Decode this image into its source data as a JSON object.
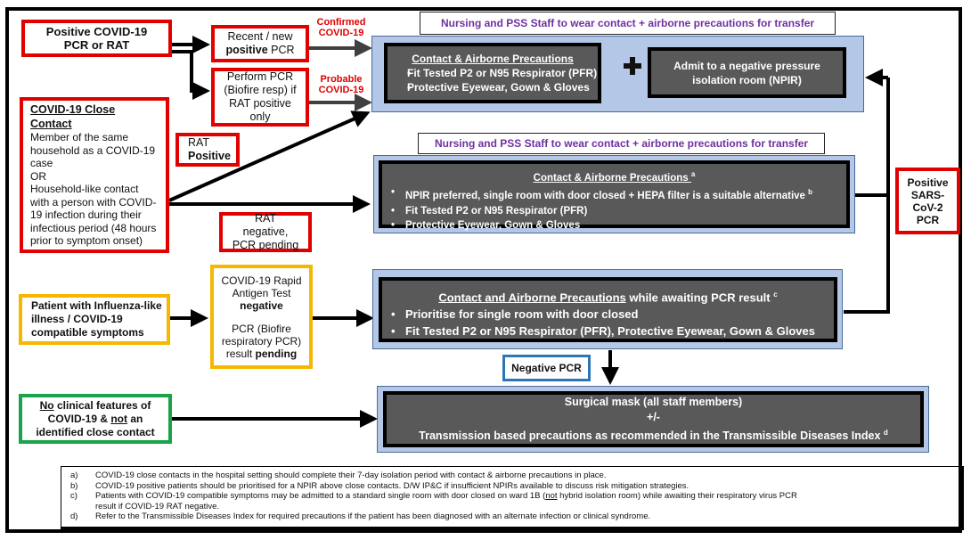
{
  "left_boxes": {
    "positive_covid": "Positive COVID-19 PCR or RAT",
    "close_contact": {
      "title": "COVID-19 Close Contact",
      "line1": "Member of the same household as a COVID-19 case",
      "or": "OR",
      "line2": "Household-like contact with a person with COVID-19 infection during their infectious period (48 hours prior to symptom onset)"
    },
    "influenza": "Patient with Influenza-like illness / COVID-19 compatible symptoms",
    "no_features": {
      "part1": "No",
      "part2": " clinical features of COVID-19 & ",
      "part3": "not",
      "part4": " an identified close contact"
    }
  },
  "middle_boxes": {
    "recent_pcr": {
      "line1": "Recent / new",
      "bold": "positive",
      "rest": " PCR"
    },
    "perform_pcr": "Perform PCR (Biofire resp) if RAT positive only",
    "rat_positive": {
      "line1": "RAT",
      "bold": "Positive"
    },
    "rat_negative": "RAT negative, PCR pending",
    "rapid_antigen": {
      "line1": "COVID-19 Rapid Antigen Test",
      "bold1": "negative",
      "line2": "PCR (Biofire respiratory PCR) result",
      "bold2": "pending"
    },
    "negative_pcr": "Negative PCR"
  },
  "labels": {
    "confirmed": "Confirmed COVID-19",
    "probable": "Probable COVID-19"
  },
  "transfer_notes": [
    "Nursing and PSS Staff to wear contact + airborne precautions for transfer",
    "Nursing and PSS Staff to wear contact + airborne precautions for transfer"
  ],
  "panel1": {
    "title": "Contact & Airborne Precautions",
    "items": [
      "Fit Tested P2 or N95 Respirator (PFR)",
      "Protective Eyewear, Gown & Gloves"
    ],
    "plus_icon": "plus-icon",
    "npir": "Admit to a negative pressure isolation room (NPIR)"
  },
  "panel2": {
    "title": "Contact & Airborne Precautions",
    "title_sup": "a",
    "items": [
      {
        "text": "NPIR preferred, single room with door closed + HEPA filter is a suitable alternative",
        "sup": "b"
      },
      {
        "text": "Fit Tested P2 or N95 Respirator (PFR)",
        "sup": ""
      },
      {
        "text": "Protective Eyewear, Gown & Gloves",
        "sup": ""
      }
    ]
  },
  "panel3": {
    "title": "Contact and Airborne Precautions",
    "title_rest": " while awaiting PCR result ",
    "title_sup": "c",
    "items": [
      "Prioritise for single room with door closed",
      "Fit Tested P2 or N95 Respirator (PFR), Protective Eyewear, Gown & Gloves"
    ]
  },
  "panel4": {
    "line1": "Surgical mask (all staff members)",
    "line2": "+/-",
    "line3": "Transmission based precautions as recommended in the Transmissible Diseases Index",
    "sup": "d"
  },
  "right_box": "Positive SARS-CoV-2 PCR",
  "footnotes": [
    {
      "label": "a)",
      "text": "COVID-19 close contacts in the hospital setting should complete their 7-day isolation period with contact & airborne precautions in place."
    },
    {
      "label": "b)",
      "text": "COVID-19 positive patients should be prioritised for a NPIR above close contacts. D/W IP&C if insufficient NPIRs available to discuss risk mitigation strategies."
    },
    {
      "label": "c)",
      "text_pre": "Patients with COVID-19 compatible symptoms may be admitted to a standard single room with door closed on ward 1B (",
      "text_u": "not",
      "text_post": " hybrid isolation room) while awaiting their respiratory virus PCR result if COVID-19 RAT negative."
    },
    {
      "label": "d)",
      "text": "Refer to the Transmissible Diseases Index for required precautions if the patient has been diagnosed with an alternate infection or clinical syndrome."
    }
  ]
}
